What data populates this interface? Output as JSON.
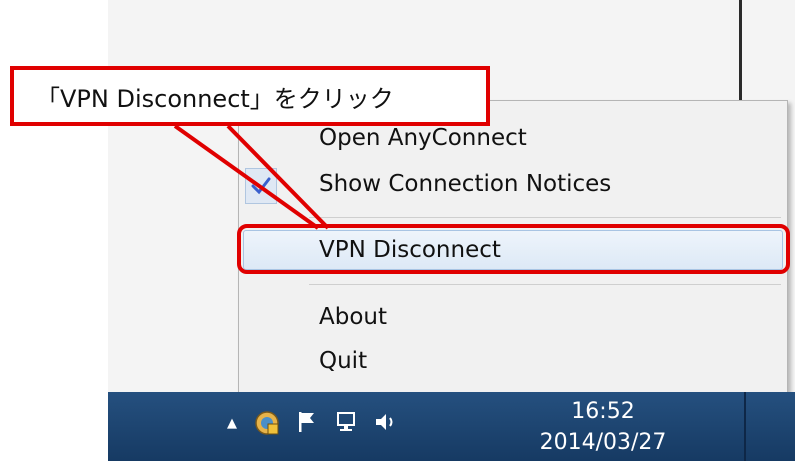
{
  "annotation": {
    "callout_text": "「VPN Disconnect」をクリック",
    "highlight_color": "#e00000"
  },
  "context_menu": {
    "items": [
      {
        "label": "Open AnyConnect",
        "checked": false
      },
      {
        "label": "Show Connection Notices",
        "checked": true
      },
      {
        "label": "VPN Disconnect",
        "checked": false,
        "highlighted": true
      },
      {
        "label": "About",
        "checked": false
      },
      {
        "label": "Quit",
        "checked": false
      }
    ],
    "check_icon": "checkmark-icon"
  },
  "taskbar": {
    "tray_icons": [
      "show-hidden-icons",
      "anyconnect-icon",
      "action-center-flag-icon",
      "network-icon",
      "volume-icon"
    ],
    "clock": {
      "time": "16:52",
      "date": "2014/03/27"
    }
  },
  "colors": {
    "taskbar": "#1d4674",
    "menu_background": "#f1f1f1",
    "check_color": "#3a5fcd"
  }
}
